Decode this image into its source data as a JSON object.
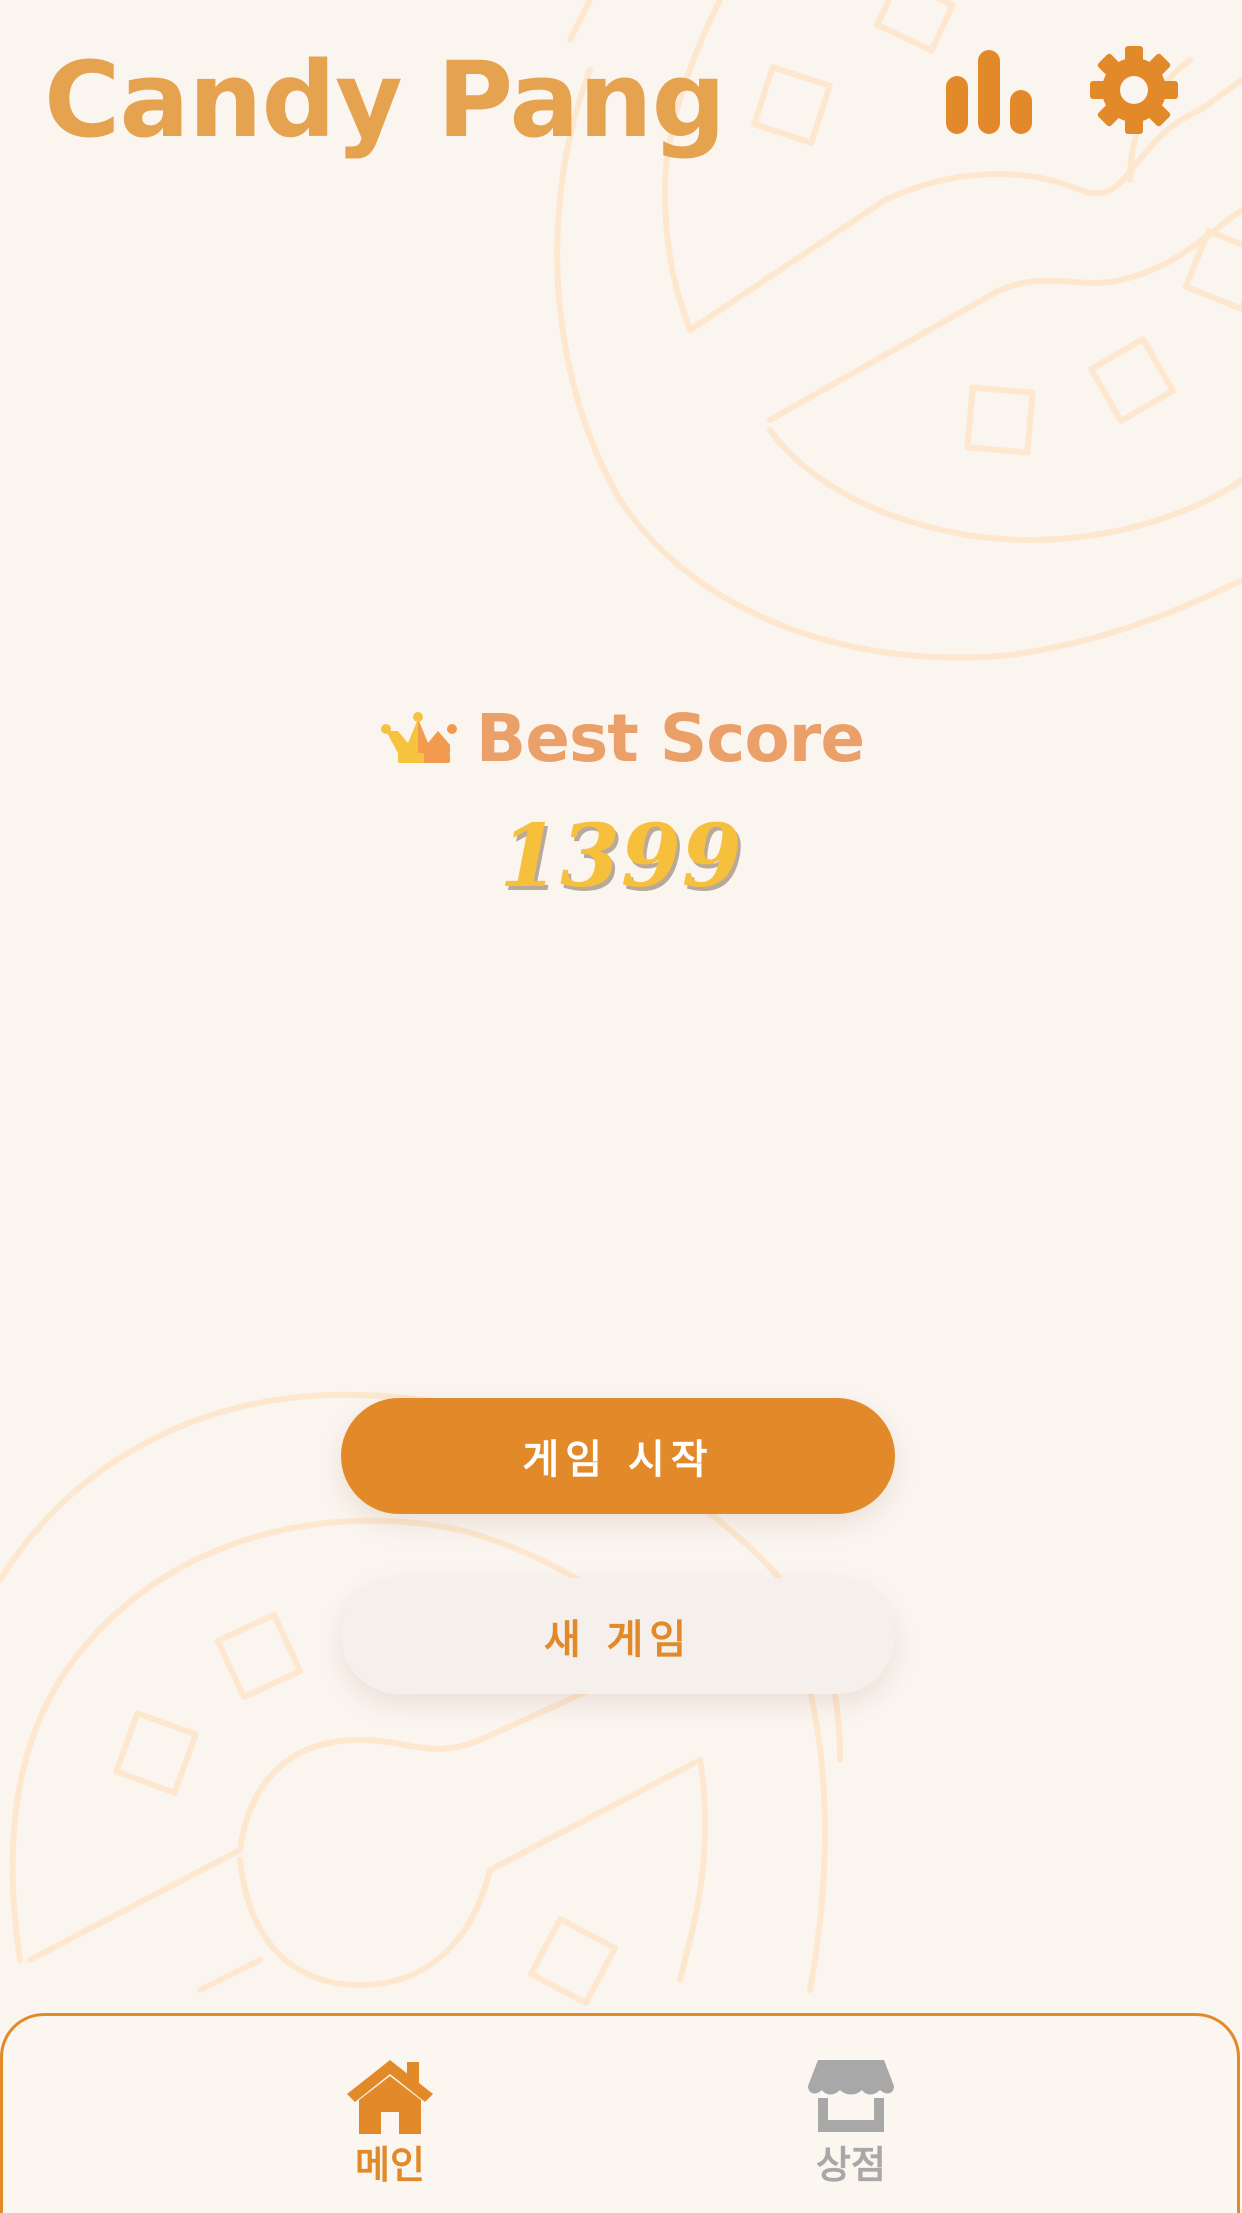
{
  "app": {
    "title": "Candy Pang"
  },
  "header": {
    "stats_icon": "bar-chart-icon",
    "settings_icon": "gear-icon"
  },
  "best": {
    "icon": "crown-icon",
    "label": "Best Score",
    "score": "1399"
  },
  "buttons": {
    "start_label": "게임 시작",
    "new_label": "새 게임"
  },
  "nav": {
    "items": [
      {
        "label": "메인",
        "icon": "home-icon",
        "active": true
      },
      {
        "label": "상점",
        "icon": "shop-icon",
        "active": false
      }
    ]
  },
  "colors": {
    "accent": "#e28a2a",
    "title": "#e5a24f",
    "score": "#f6bf3c",
    "background": "#fbf5f0",
    "inactive": "#a8a8a8"
  }
}
